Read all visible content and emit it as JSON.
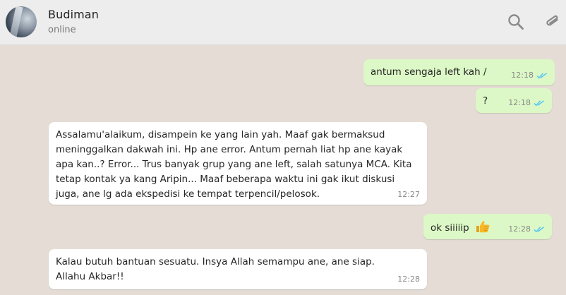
{
  "header": {
    "contact_name": "Budiman",
    "status": "online",
    "icons": [
      "search-icon",
      "attach-icon"
    ]
  },
  "colors": {
    "header_bg": "#ededed",
    "chat_bg": "#e5ddd5",
    "outgoing_bubble": "#dcf8c6",
    "incoming_bubble": "#ffffff",
    "read_ticks": "#4fc3f7"
  },
  "messages": [
    {
      "direction": "outgoing",
      "text": "antum sengaja left kah /",
      "time": "12:18",
      "status": "read"
    },
    {
      "direction": "outgoing",
      "text": "?",
      "time": "12:18",
      "status": "read"
    },
    {
      "direction": "incoming",
      "text": "Assalamu'alaikum, disampein ke yang lain yah. Maaf gak bermaksud meninggalkan dakwah ini. Hp ane error. Antum pernah liat hp ane kayak apa kan..? Error... Trus banyak grup yang ane left, salah satunya MCA. Kita tetap kontak ya kang Aripin... Maaf beberapa waktu ini gak ikut diskusi juga, ane lg ada ekspedisi ke tempat terpencil/pelosok.",
      "time": "12:27"
    },
    {
      "direction": "outgoing",
      "text": "ok siiiiip",
      "emoji": "thumbs-up-icon",
      "time": "12:28",
      "status": "read"
    },
    {
      "direction": "incoming",
      "text": "Kalau butuh bantuan sesuatu. Insya Allah semampu ane, ane siap. Allahu Akbar!!",
      "time": "12:28"
    }
  ]
}
